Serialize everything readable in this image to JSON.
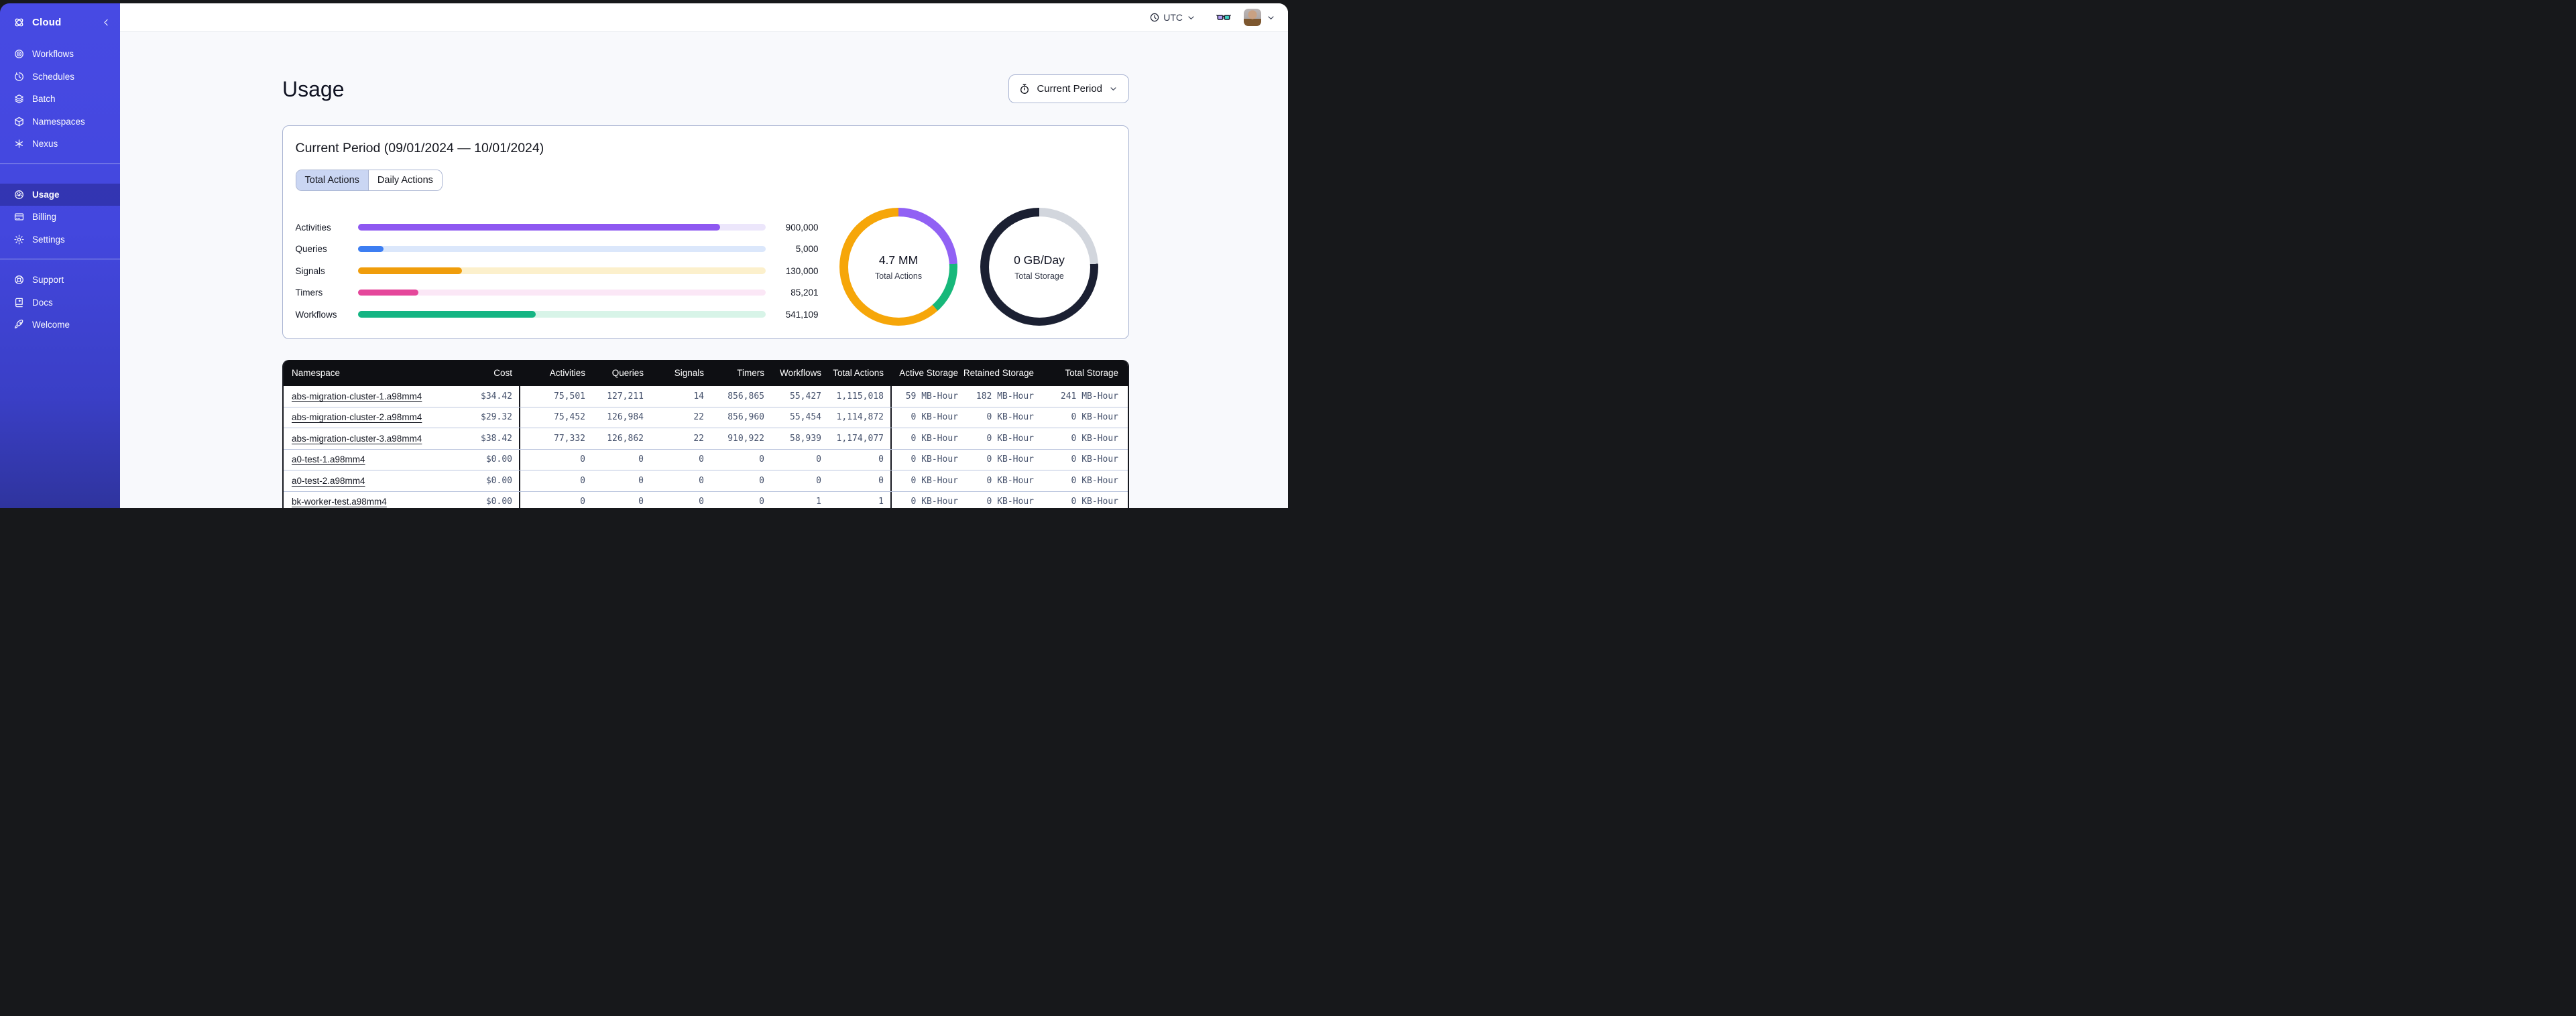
{
  "topbar": {
    "timezone": {
      "icon": "clock-icon",
      "label": "UTC",
      "chevron_icon": "chevron-down-icon"
    },
    "labs_icon": "glasses-icon",
    "user": {
      "avatar": "user-avatar",
      "chevron_icon": "chevron-down-icon"
    }
  },
  "sidebar": {
    "logo": {
      "icon": "temporal-logo-icon",
      "label": "Cloud",
      "collapse_icon": "chevron-left-icon"
    },
    "sections": [
      {
        "items": [
          {
            "label": "Workflows",
            "icon": "workflows-icon",
            "active": false
          },
          {
            "label": "Schedules",
            "icon": "schedules-icon",
            "active": false
          },
          {
            "label": "Batch",
            "icon": "batch-icon",
            "active": false
          },
          {
            "label": "Namespaces",
            "icon": "namespaces-icon",
            "active": false
          },
          {
            "label": "Nexus",
            "icon": "nexus-icon",
            "active": false
          }
        ]
      },
      {
        "items": [
          {
            "label": "Usage",
            "icon": "usage-icon",
            "active": true
          },
          {
            "label": "Billing",
            "icon": "billing-icon",
            "active": false
          },
          {
            "label": "Settings",
            "icon": "settings-icon",
            "active": false
          }
        ]
      },
      {
        "items": [
          {
            "label": "Support",
            "icon": "support-icon",
            "active": false
          },
          {
            "label": "Docs",
            "icon": "docs-icon",
            "active": false
          },
          {
            "label": "Welcome",
            "icon": "welcome-icon",
            "active": false
          }
        ]
      }
    ]
  },
  "page": {
    "title": "Usage",
    "period_button": {
      "icon": "stopwatch-icon",
      "label": "Current Period",
      "chevron_icon": "chevron-down-icon"
    },
    "card": {
      "title": "Current Period (09/01/2024 — 10/01/2024)",
      "tabs": [
        {
          "label": "Total Actions",
          "active": true
        },
        {
          "label": "Daily Actions",
          "active": false
        }
      ]
    }
  },
  "chart_data": [
    {
      "type": "bar",
      "orientation": "horizontal",
      "categories": [
        "Activities",
        "Queries",
        "Signals",
        "Timers",
        "Workflows"
      ],
      "values": [
        900000,
        5000,
        130000,
        85201,
        541109
      ],
      "value_labels": [
        "900,000",
        "5,000",
        "130,000",
        "85,201",
        "541,109"
      ],
      "bar_colors": [
        "#8e58f1",
        "#3d7ef2",
        "#f09d0b",
        "#e5479b",
        "#14b583"
      ],
      "track_colors": [
        "#ece6fb",
        "#dbe7fb",
        "#fcf0cc",
        "#fbe7f6",
        "#d8f4e8"
      ],
      "fill_pct": [
        88.9,
        6.4,
        25.5,
        14.9,
        43.6
      ],
      "grid": false,
      "legend": false
    },
    {
      "type": "pie",
      "style": "donut",
      "center_value": "4.7 MM",
      "center_label": "Total Actions",
      "segments": [
        {
          "color": "#9161f4",
          "pct": 24.2
        },
        {
          "color": "#17b87a",
          "pct": 14.2
        },
        {
          "color": "#f6a609",
          "pct": 61.6
        }
      ]
    },
    {
      "type": "pie",
      "style": "donut",
      "center_value": "0 GB/Day",
      "center_label": "Total Storage",
      "segments": [
        {
          "color": "#d2d6dd",
          "pct": 24.2
        },
        {
          "color": "#1b2032",
          "pct": 75.8
        }
      ]
    }
  ],
  "table": {
    "columns": [
      {
        "label": "Namespace",
        "align": "left"
      },
      {
        "label": "Cost",
        "align": "right"
      },
      {
        "label": "Activities",
        "align": "right"
      },
      {
        "label": "Queries",
        "align": "right"
      },
      {
        "label": "Signals",
        "align": "right"
      },
      {
        "label": "Timers",
        "align": "right"
      },
      {
        "label": "Workflows",
        "align": "right"
      },
      {
        "label": "Total Actions",
        "align": "right"
      },
      {
        "label": "Active Storage",
        "align": "right"
      },
      {
        "label": "Retained Storage",
        "align": "right"
      },
      {
        "label": "Total Storage",
        "align": "right"
      }
    ],
    "rows": [
      {
        "namespace": "abs-migration-cluster-1.a98mm4",
        "cells": [
          "$34.42",
          "75,501",
          "127,211",
          "14",
          "856,865",
          "55,427",
          "1,115,018",
          "59 MB-Hour",
          "182 MB-Hour",
          "241 MB-Hour"
        ]
      },
      {
        "namespace": "abs-migration-cluster-2.a98mm4",
        "cells": [
          "$29.32",
          "75,452",
          "126,984",
          "22",
          "856,960",
          "55,454",
          "1,114,872",
          "0 KB-Hour",
          "0 KB-Hour",
          "0 KB-Hour"
        ]
      },
      {
        "namespace": "abs-migration-cluster-3.a98mm4",
        "cells": [
          "$38.42",
          "77,332",
          "126,862",
          "22",
          "910,922",
          "58,939",
          "1,174,077",
          "0 KB-Hour",
          "0 KB-Hour",
          "0 KB-Hour"
        ]
      },
      {
        "namespace": "a0-test-1.a98mm4",
        "cells": [
          "$0.00",
          "0",
          "0",
          "0",
          "0",
          "0",
          "0",
          "0 KB-Hour",
          "0 KB-Hour",
          "0 KB-Hour"
        ]
      },
      {
        "namespace": "a0-test-2.a98mm4",
        "cells": [
          "$0.00",
          "0",
          "0",
          "0",
          "0",
          "0",
          "0",
          "0 KB-Hour",
          "0 KB-Hour",
          "0 KB-Hour"
        ]
      },
      {
        "namespace": "bk-worker-test.a98mm4",
        "cells": [
          "$0.00",
          "0",
          "0",
          "0",
          "0",
          "1",
          "1",
          "0 KB-Hour",
          "0 KB-Hour",
          "0 KB-Hour"
        ]
      }
    ]
  }
}
